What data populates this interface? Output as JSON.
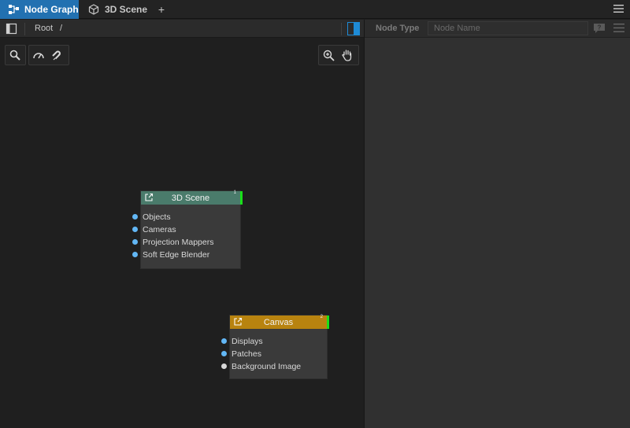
{
  "tabs": [
    {
      "label": "Node Graph",
      "icon": "node-graph-icon",
      "active": true
    },
    {
      "label": "3D Scene",
      "icon": "cube-icon",
      "active": false
    }
  ],
  "tab_add_label": "+",
  "breadcrumb": {
    "root": "Root",
    "separator": "/"
  },
  "inspector": {
    "node_type_label": "Node Type",
    "node_name_placeholder": "Node Name"
  },
  "nodes": [
    {
      "title": "3D Scene",
      "count": "1",
      "header_color": "#4a7b6b",
      "ports": [
        {
          "label": "Objects",
          "color": "#62b7f5"
        },
        {
          "label": "Cameras",
          "color": "#62b7f5"
        },
        {
          "label": "Projection Mappers",
          "color": "#62b7f5"
        },
        {
          "label": "Soft Edge Blender",
          "color": "#62b7f5"
        }
      ]
    },
    {
      "title": "Canvas",
      "count": "2",
      "header_color": "#b8830f",
      "ports": [
        {
          "label": "Displays",
          "color": "#62b7f5"
        },
        {
          "label": "Patches",
          "color": "#62b7f5"
        },
        {
          "label": "Background Image",
          "color": "#d8d8d8"
        }
      ]
    }
  ],
  "colors": {
    "accent": "#2271b1",
    "status_green": "#19e019"
  }
}
